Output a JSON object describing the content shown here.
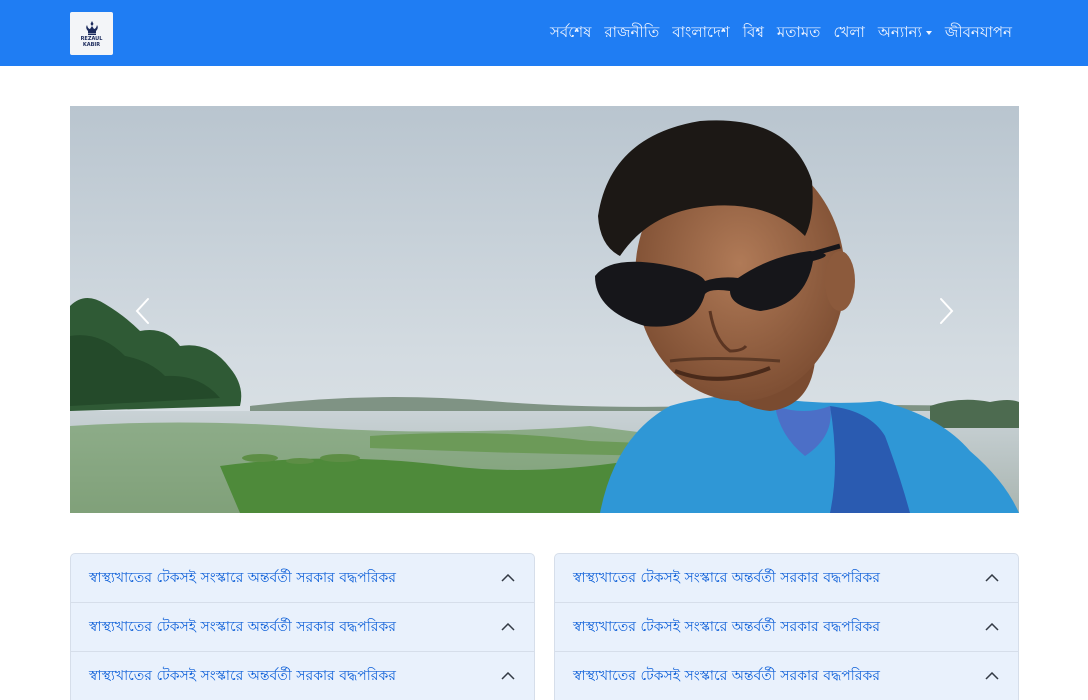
{
  "brand": {
    "logo_line1": "REZAUL",
    "logo_line2": "KABIR",
    "logo_icon": "crown-emblem-icon"
  },
  "nav": {
    "items": [
      {
        "label": "সর্বশেষ"
      },
      {
        "label": "রাজনীতি"
      },
      {
        "label": "বাংলাদেশ"
      },
      {
        "label": "বিশ্ব"
      },
      {
        "label": "মতামত"
      },
      {
        "label": "খেলা"
      },
      {
        "label": "অন্যান্য",
        "dropdown": true
      },
      {
        "label": "জীবনযাপন"
      }
    ]
  },
  "carousel": {
    "prev_icon": "chevron-left-icon",
    "next_icon": "chevron-right-icon"
  },
  "accordion": {
    "left": [
      {
        "title": "স্বাস্থ্যখাতের টেকসই সংস্কারে অন্তর্বর্তী সরকার বদ্ধপরিকর"
      },
      {
        "title": "স্বাস্থ্যখাতের টেকসই সংস্কারে অন্তর্বর্তী সরকার বদ্ধপরিকর"
      },
      {
        "title": "স্বাস্থ্যখাতের টেকসই সংস্কারে অন্তর্বর্তী সরকার বদ্ধপরিকর"
      }
    ],
    "right": [
      {
        "title": "স্বাস্থ্যখাতের টেকসই সংস্কারে অন্তর্বর্তী সরকার বদ্ধপরিকর"
      },
      {
        "title": "স্বাস্থ্যখাতের টেকসই সংস্কারে অন্তর্বর্তী সরকার বদ্ধপরিকর"
      },
      {
        "title": "স্বাস্থ্যখাতের টেকসই সংস্কারে অন্তর্বর্তী সরকার বদ্ধপরিকর"
      }
    ]
  },
  "colors": {
    "navbar": "#1f7df3",
    "accordion_bg": "#e9f1fc",
    "accordion_text": "#0d5fd8"
  }
}
